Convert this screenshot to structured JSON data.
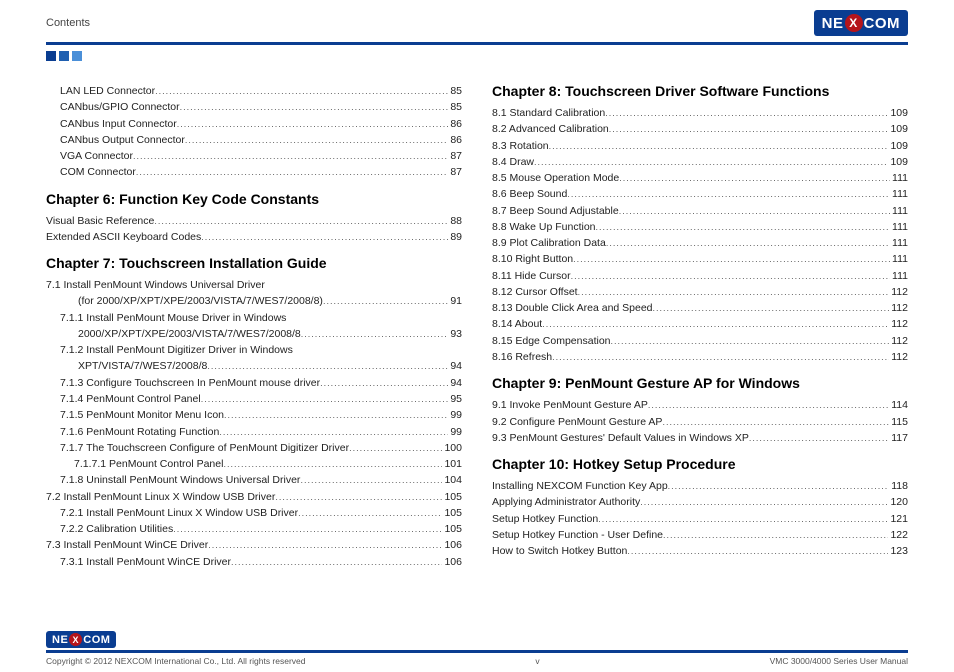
{
  "header": {
    "contents": "Contents",
    "brand": "NEXCOM"
  },
  "footer": {
    "copyright": "Copyright © 2012 NEXCOM International Co., Ltd. All rights reserved",
    "page": "v",
    "manual": "VMC 3000/4000 Series User Manual"
  },
  "left": {
    "pre_items": [
      {
        "label": "LAN LED Connector",
        "page": "85",
        "indent": 1
      },
      {
        "label": "CANbus/GPIO Connector",
        "page": "85",
        "indent": 1
      },
      {
        "label": "CANbus Input Connector",
        "page": "86",
        "indent": 1
      },
      {
        "label": "CANbus Output Connector",
        "page": "86",
        "indent": 1
      },
      {
        "label": "VGA Connector",
        "page": "87",
        "indent": 1
      },
      {
        "label": "COM Connector",
        "page": "87",
        "indent": 1
      }
    ],
    "ch6_title": "Chapter 6: Function Key Code Constants",
    "ch6_items": [
      {
        "label": "Visual Basic Reference",
        "page": "88",
        "indent": 0
      },
      {
        "label": "Extended ASCII Keyboard Codes",
        "page": "89",
        "indent": 0
      }
    ],
    "ch7_title": "Chapter 7: Touchscreen Installation Guide",
    "ch7_items": [
      {
        "label": "7.1  Install PenMount Windows Universal Driver",
        "page": "",
        "indent": 0,
        "nodots": true
      },
      {
        "label": "(for 2000/XP/XPT/XPE/2003/VISTA/7/WES7/2008/8)",
        "page": "91",
        "indent": 0,
        "cont": true
      },
      {
        "label": "7.1.1  Install PenMount Mouse Driver in Windows",
        "page": "",
        "indent": 1,
        "nodots": true
      },
      {
        "label": "2000/XP/XPT/XPE/2003/VISTA/7/WES7/2008/8",
        "page": "93",
        "indent": 1,
        "cont": true
      },
      {
        "label": "7.1.2  Install PenMount Digitizer Driver in Windows",
        "page": "",
        "indent": 1,
        "nodots": true
      },
      {
        "label": "XPT/VISTA/7/WES7/2008/8",
        "page": "94",
        "indent": 1,
        "cont": true
      },
      {
        "label": "7.1.3  Configure Touchscreen In PenMount mouse driver",
        "page": "94",
        "indent": 1
      },
      {
        "label": "7.1.4  PenMount Control Panel",
        "page": "95",
        "indent": 1
      },
      {
        "label": "7.1.5  PenMount Monitor Menu Icon",
        "page": "99",
        "indent": 1
      },
      {
        "label": "7.1.6  PenMount Rotating Function",
        "page": "99",
        "indent": 1
      },
      {
        "label": "7.1.7  The Touchscreen Configure of PenMount Digitizer Driver",
        "page": "100",
        "indent": 1
      },
      {
        "label": "7.1.7.1  PenMount Control Panel",
        "page": "101",
        "indent": 2
      },
      {
        "label": "7.1.8  Uninstall PenMount Windows Universal Driver",
        "page": "104",
        "indent": 1
      },
      {
        "label": "7.2  Install PenMount Linux X Window USB Driver",
        "page": "105",
        "indent": 0
      },
      {
        "label": "7.2.1  Install PenMount Linux X Window USB Driver",
        "page": "105",
        "indent": 1
      },
      {
        "label": "7.2.2  Calibration Utilities",
        "page": "105",
        "indent": 1
      },
      {
        "label": "7.3  Install PenMount WinCE Driver",
        "page": "106",
        "indent": 0
      },
      {
        "label": "7.3.1  Install PenMount WinCE Driver",
        "page": "106",
        "indent": 1
      }
    ]
  },
  "right": {
    "ch8_title": "Chapter 8: Touchscreen Driver Software Functions",
    "ch8_items": [
      {
        "label": "8.1  Standard Calibration",
        "page": "109"
      },
      {
        "label": "8.2  Advanced Calibration",
        "page": "109"
      },
      {
        "label": "8.3  Rotation",
        "page": "109"
      },
      {
        "label": "8.4  Draw",
        "page": "109"
      },
      {
        "label": "8.5  Mouse Operation Mode",
        "page": "111"
      },
      {
        "label": "8.6  Beep Sound",
        "page": "111"
      },
      {
        "label": "8.7  Beep Sound Adjustable",
        "page": "111"
      },
      {
        "label": "8.8  Wake Up Function",
        "page": "111"
      },
      {
        "label": "8.9  Plot Calibration Data",
        "page": "111"
      },
      {
        "label": "8.10  Right Button",
        "page": "111"
      },
      {
        "label": "8.11  Hide Cursor",
        "page": "111"
      },
      {
        "label": "8.12  Cursor Offset",
        "page": "112"
      },
      {
        "label": "8.13  Double Click Area and Speed",
        "page": "112"
      },
      {
        "label": "8.14  About",
        "page": "112"
      },
      {
        "label": "8.15  Edge Compensation",
        "page": "112"
      },
      {
        "label": "8.16  Refresh",
        "page": "112"
      }
    ],
    "ch9_title": "Chapter 9: PenMount Gesture AP for Windows",
    "ch9_items": [
      {
        "label": "9.1  Invoke PenMount Gesture AP",
        "page": "114"
      },
      {
        "label": "9.2  Configure PenMount Gesture AP",
        "page": "115"
      },
      {
        "label": "9.3  PenMount Gestures' Default Values in Windows XP",
        "page": "117"
      }
    ],
    "ch10_title": "Chapter 10: Hotkey Setup Procedure",
    "ch10_items": [
      {
        "label": "Installing NEXCOM Function Key App",
        "page": "118"
      },
      {
        "label": "Applying Administrator Authority",
        "page": "120"
      },
      {
        "label": "Setup Hotkey Function",
        "page": "121"
      },
      {
        "label": "Setup Hotkey Function - User Define",
        "page": "122"
      },
      {
        "label": "How to Switch Hotkey Button",
        "page": "123"
      }
    ]
  }
}
